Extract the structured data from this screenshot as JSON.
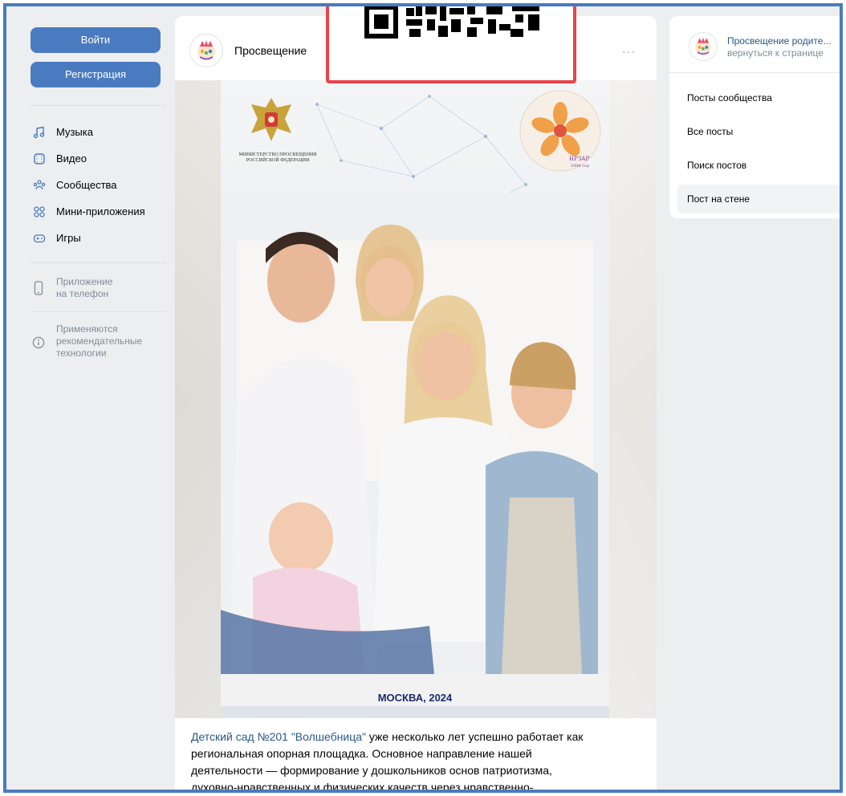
{
  "sidebar": {
    "login_label": "Войти",
    "register_label": "Регистрация",
    "nav": [
      {
        "label": "Музыка",
        "icon": "music-icon"
      },
      {
        "label": "Видео",
        "icon": "video-icon"
      },
      {
        "label": "Сообщества",
        "icon": "communities-icon"
      },
      {
        "label": "Мини-приложения",
        "icon": "mini-apps-icon"
      },
      {
        "label": "Игры",
        "icon": "gamepad-icon"
      }
    ],
    "app_label_1": "Приложение",
    "app_label_2": "на телефон",
    "recs_1": "Применяются",
    "recs_2": "рекомендательные",
    "recs_3": "технологии"
  },
  "post": {
    "author": "Просвещение",
    "more": "···",
    "poster_ministry_1": "МИНИСТЕРСТВО ПРОСВЕЩЕНИЯ",
    "poster_ministry_2": "РОССИЙСКОЙ ФЕДЕРАЦИИ",
    "poster_org": "НРЗАР",
    "poster_year": "1944 год",
    "poster_city": "МОСКВА, 2024",
    "text_link": "Детский сад №201 \"Волшебница\"",
    "text_1": " уже несколько лет успешно работает как",
    "text_2": "региональная опорная площадка. Основное направление нашей",
    "text_3": "деятельности — формирование у дошкольников основ патриотизма,",
    "text_4": "духовно-нравственных и физических качеств через нравственно-"
  },
  "right_panel": {
    "group_name": "Просвещение родите...",
    "back_link": "вернуться к странице",
    "items": [
      "Посты сообщества",
      "Все посты",
      "Поиск постов",
      "Пост на стене"
    ],
    "active_index": 3
  },
  "colors": {
    "accent": "#4a7bc0",
    "qr_border": "#e8454b",
    "link": "#2a5885",
    "bg": "#edeef0"
  }
}
